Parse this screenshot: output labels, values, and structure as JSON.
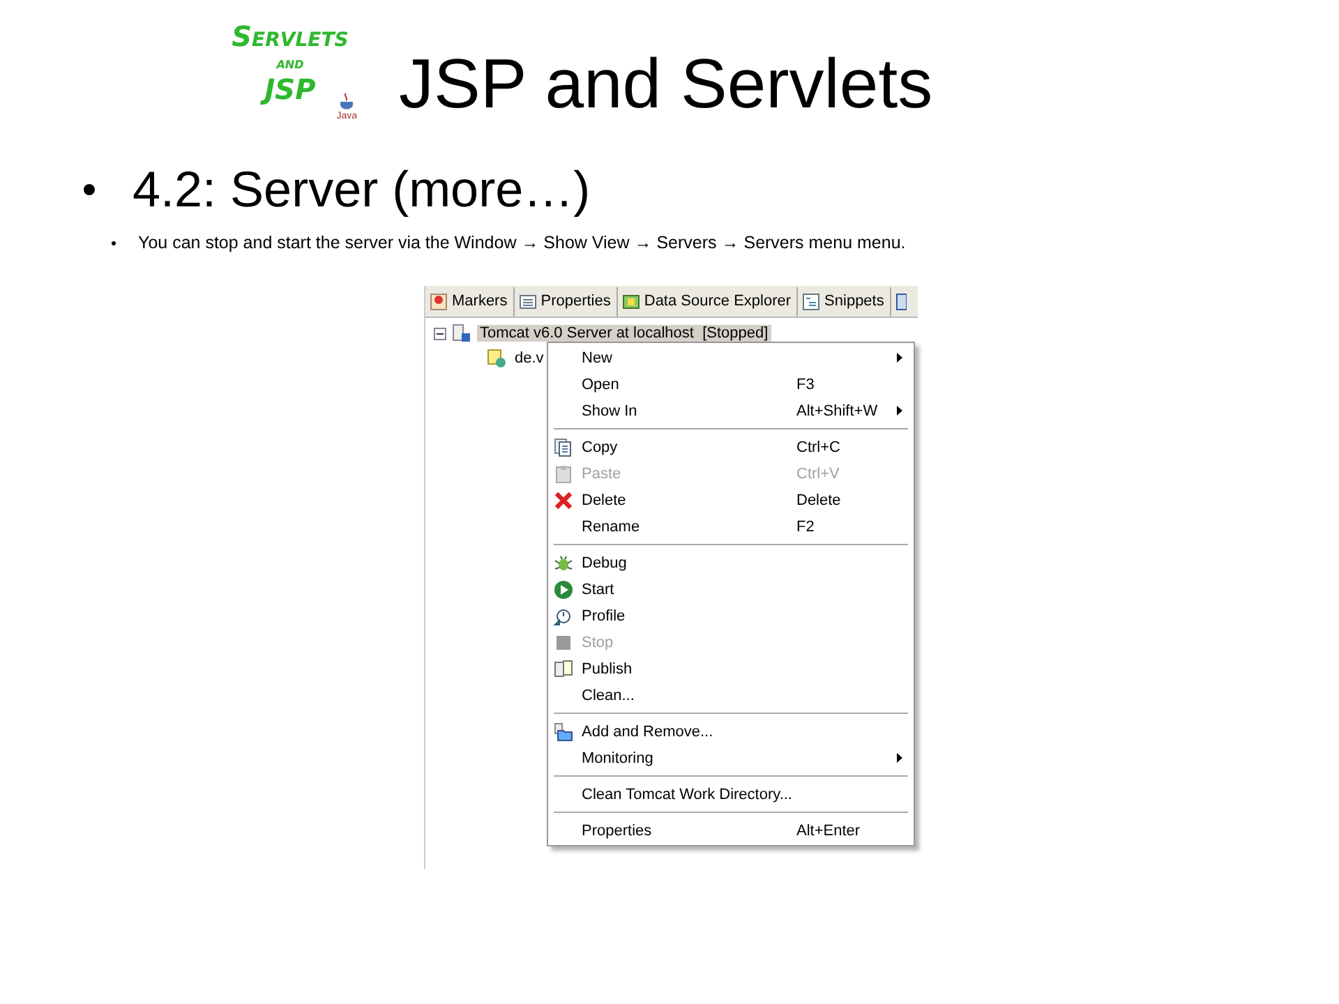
{
  "logo": {
    "lines": [
      "Servlets",
      "and",
      "JSP"
    ],
    "caption": "Java"
  },
  "title": "JSP and Servlets",
  "bullet": "4.2: Server (more…)",
  "sub_bullet": "You can stop and start the server via the Window → Show View → Servers → Servers menu menu.",
  "screenshot": {
    "tabs": [
      {
        "label": "Markers",
        "selected": false
      },
      {
        "label": "Properties",
        "selected": false
      },
      {
        "label": "Data Source Explorer",
        "selected": false
      },
      {
        "label": "Snippets",
        "selected": false
      }
    ],
    "tree": [
      {
        "label": "Tomcat v6.0 Server at localhost  [Stopped]",
        "selected": true,
        "expanded": true,
        "children": [
          {
            "label": "de.v",
            "selected": false
          }
        ]
      }
    ],
    "context_menu": [
      {
        "kind": "item",
        "label": "New",
        "submenu": true,
        "disabled": false
      },
      {
        "kind": "item",
        "label": "Open",
        "shortcut": "F3",
        "submenu": false,
        "disabled": false
      },
      {
        "kind": "item",
        "label": "Show In",
        "shortcut": "Alt+Shift+W",
        "submenu": true,
        "disabled": false
      },
      {
        "kind": "separator"
      },
      {
        "kind": "item",
        "label": "Copy",
        "shortcut": "Ctrl+C",
        "submenu": false,
        "disabled": false
      },
      {
        "kind": "item",
        "label": "Paste",
        "shortcut": "Ctrl+V",
        "submenu": false,
        "disabled": true
      },
      {
        "kind": "item",
        "label": "Delete",
        "shortcut": "Delete",
        "submenu": false,
        "disabled": false
      },
      {
        "kind": "item",
        "label": "Rename",
        "shortcut": "F2",
        "submenu": false,
        "disabled": false
      },
      {
        "kind": "separator"
      },
      {
        "kind": "item",
        "label": "Debug",
        "submenu": false,
        "disabled": false
      },
      {
        "kind": "item",
        "label": "Start",
        "submenu": false,
        "disabled": false
      },
      {
        "kind": "item",
        "label": "Profile",
        "submenu": false,
        "disabled": false
      },
      {
        "kind": "item",
        "label": "Stop",
        "submenu": false,
        "disabled": true
      },
      {
        "kind": "item",
        "label": "Publish",
        "submenu": false,
        "disabled": false
      },
      {
        "kind": "item",
        "label": "Clean...",
        "submenu": false,
        "disabled": false
      },
      {
        "kind": "separator"
      },
      {
        "kind": "item",
        "label": "Add and Remove...",
        "submenu": false,
        "disabled": false
      },
      {
        "kind": "item",
        "label": "Monitoring",
        "submenu": true,
        "disabled": false
      },
      {
        "kind": "separator"
      },
      {
        "kind": "item",
        "label": "Clean Tomcat Work Directory...",
        "submenu": false,
        "disabled": false
      },
      {
        "kind": "separator"
      },
      {
        "kind": "item",
        "label": "Properties",
        "shortcut": "Alt+Enter",
        "submenu": false,
        "disabled": false
      }
    ]
  }
}
